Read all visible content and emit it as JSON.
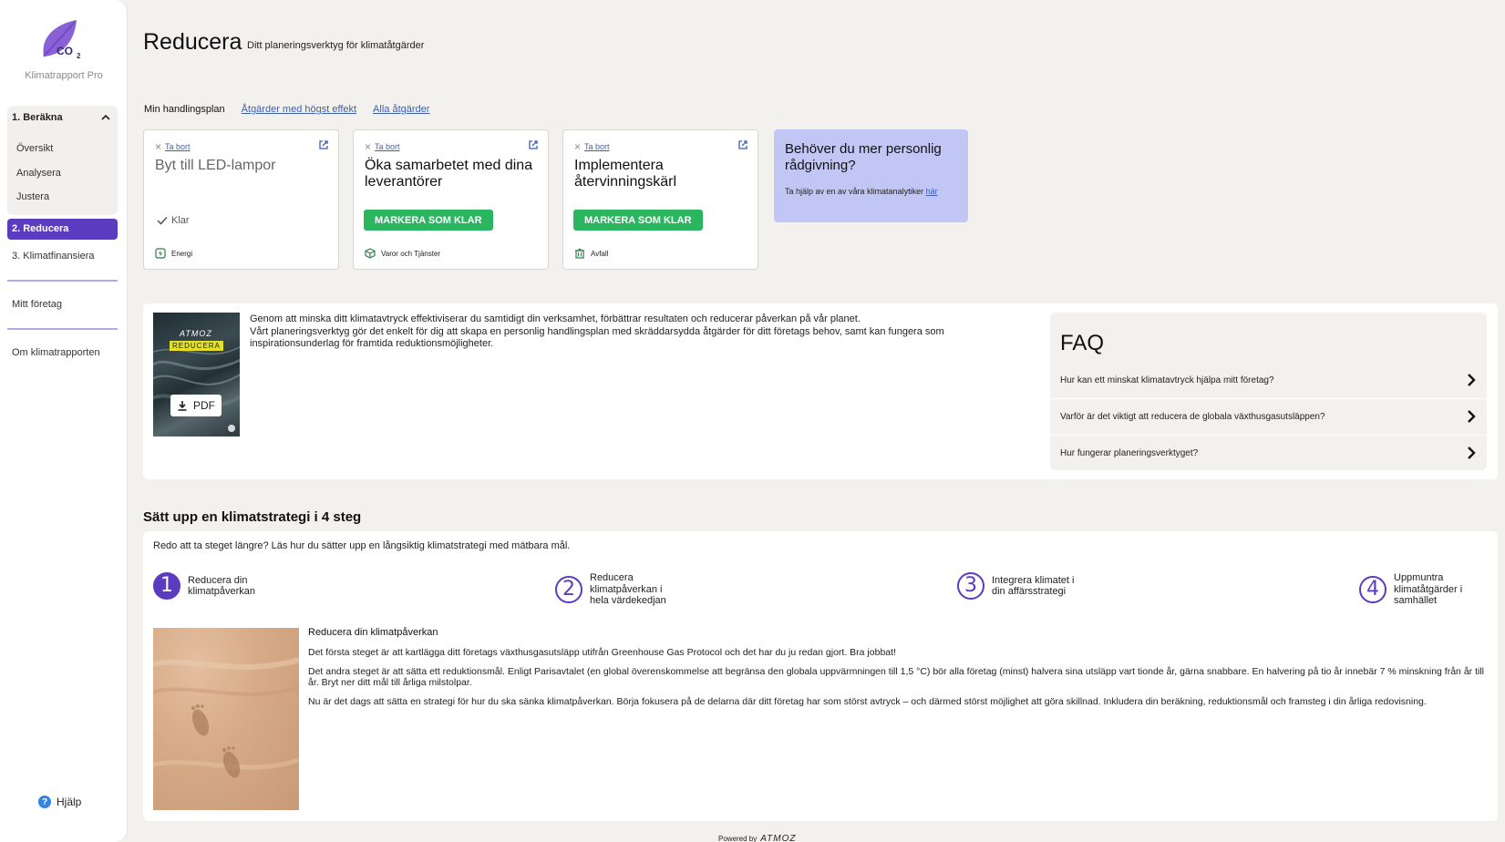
{
  "sidebar": {
    "app_name": "Klimatrapport Pro",
    "group_label": "1. Beräkna",
    "group_items": [
      "Översikt",
      "Analysera",
      "Justera"
    ],
    "active_item": "2. Reducera",
    "item_finance": "3. Klimatfinansiera",
    "item_company": "Mitt företag",
    "item_about": "Om klimatrapporten",
    "help_label": "Hjälp",
    "accent": "#5b3bc0"
  },
  "header": {
    "title": "Reducera",
    "subtitle": "Ditt planeringsverktyg för klimatåtgärder"
  },
  "tabs": {
    "current": "Min handlingsplan",
    "links": [
      "Åtgärder med högst effekt",
      "Alla åtgärder"
    ]
  },
  "cards": [
    {
      "remove": "Ta bort",
      "title": "Byt till LED-lampor",
      "status": "Klar",
      "category": "Energi"
    },
    {
      "remove": "Ta bort",
      "title": "Öka samarbetet med dina leverantörer",
      "button": "MARKERA SOM KLAR",
      "category": "Varor och Tjänster"
    },
    {
      "remove": "Ta bort",
      "title": "Implementera återvinningskärl",
      "button": "MARKERA SOM KLAR",
      "category": "Avfall"
    }
  ],
  "advice": {
    "heading": "Behöver du mer personlig rådgivning?",
    "text": "Ta hjälp av en av våra klimatanalytiker",
    "link": "här"
  },
  "intro": {
    "report_brand": "ATMOZ",
    "report_tag": "REDUCERA",
    "pdf_label": "PDF",
    "line1": "Genom att minska ditt klimatavtryck effektiviserar du samtidigt din verksamhet, förbättrar resultaten och reducerar påverkan på vår planet.",
    "line2": "Vårt planeringsverktyg gör det enkelt för dig att skapa en personlig handlingsplan med skräddarsydda åtgärder för ditt företags behov, samt kan fungera som inspirationsunderlag för framtida reduktionsmöjligheter."
  },
  "faq": {
    "title": "FAQ",
    "items": [
      "Hur kan ett minskat klimatavtryck hjälpa mitt företag?",
      "Varför är det viktigt att reducera de globala växthusgasutsläppen?",
      "Hur fungerar planeringsverktyget?"
    ]
  },
  "strategy": {
    "title": "Sätt upp en klimatstrategi i 4 steg",
    "lead": "Redo att ta steget längre? Läs hur du sätter upp en långsiktig klimatstrategi med mätbara mål.",
    "steps": [
      {
        "num": "1",
        "label": "Reducera din klimatpåverkan"
      },
      {
        "num": "2",
        "label": "Reducera klimatpåverkan i hela värdekedjan"
      },
      {
        "num": "3",
        "label": "Integrera klimatet i din affärsstrategi"
      },
      {
        "num": "4",
        "label": "Uppmuntra klimatåtgärder i samhället"
      }
    ],
    "detail_heading": "Reducera din klimatpåverkan",
    "paragraphs": [
      "Det första steget är att kartlägga ditt företags växthusgasutsläpp utifrån Greenhouse Gas Protocol och det har du ju redan gjort. Bra jobbat!",
      "Det andra steget är att sätta ett reduktionsmål. Enligt Parisavtalet (en global överenskommelse att begränsa den globala uppvärmningen till 1,5 °C) bör alla företag (minst) halvera sina utsläpp vart tionde år, gärna snabbare. En halvering på tio år innebär 7 % minskning från år till år. Bryt ner ditt mål till årliga milstolpar.",
      "Nu är det dags att sätta en strategi för hur du ska sänka klimatpåverkan. Börja fokusera på de delarna där ditt företag har som störst avtryck – och därmed störst möjlighet att göra skillnad. Inkludera din beräkning, reduktionsmål och framsteg i din årliga redovisning."
    ]
  },
  "footer": {
    "powered_by": "Powered by",
    "brand": "ATMOZ"
  },
  "colors": {
    "primary_button": "#2bb55f",
    "advice_bg": "#c2c6f5",
    "link": "#3c5fb8"
  }
}
